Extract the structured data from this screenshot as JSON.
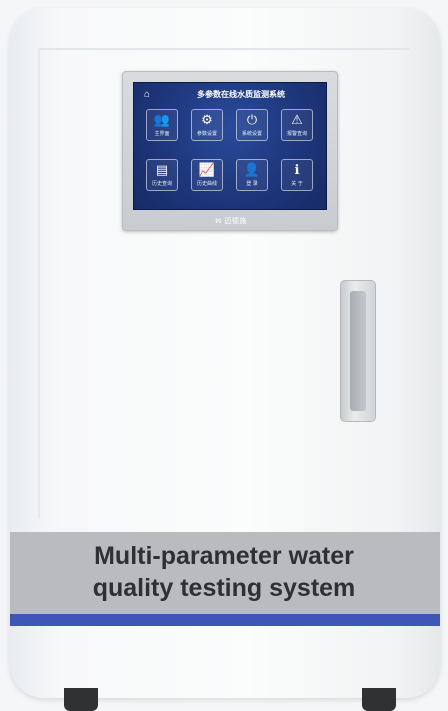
{
  "product_label": {
    "line1": "Multi-parameter water",
    "line2": "quality testing system"
  },
  "screen": {
    "title": "多参数在线水质监测系统",
    "home_icon": "home-icon",
    "tiles": [
      {
        "label": "主界面",
        "icon": "users-icon",
        "glyph": "👥"
      },
      {
        "label": "参数设置",
        "icon": "gear-icon",
        "glyph": "⚙"
      },
      {
        "label": "系统设置",
        "icon": "power-icon",
        "glyph": "⏻"
      },
      {
        "label": "报警查询",
        "icon": "alarm-icon",
        "glyph": "⚠"
      },
      {
        "label": "历史查询",
        "icon": "history-icon",
        "glyph": "▤"
      },
      {
        "label": "历史曲线",
        "icon": "chart-icon",
        "glyph": "📈"
      },
      {
        "label": "登 录",
        "icon": "user-icon",
        "glyph": "👤"
      },
      {
        "label": "关 于",
        "icon": "info-icon",
        "glyph": "ℹ"
      }
    ]
  },
  "panel_logo": "ꟽ 迈德施",
  "colors": {
    "screen_blue": "#1d3579",
    "stripe_blue": "#3e56b5",
    "label_grey": "#b9bbbe"
  }
}
